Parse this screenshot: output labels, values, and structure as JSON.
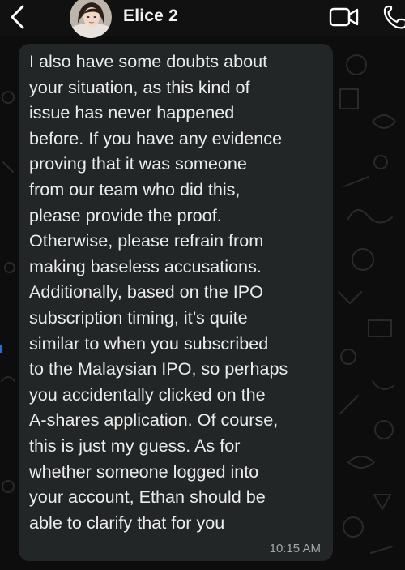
{
  "header": {
    "contact_name": "Elice 2",
    "back_icon": "chevron-left-icon",
    "video_icon": "video-camera-icon",
    "call_icon": "phone-icon"
  },
  "message": {
    "text": "I also have some doubts about\nyour situation, as this kind of\nissue has never happened\nbefore. If you have any evidence\nproving that it was someone\nfrom our team who did this,\nplease provide the proof.\nOtherwise, please refrain from\nmaking baseless accusations.\nAdditionally, based on the IPO\nsubscription timing, it’s quite\nsimilar to when you subscribed\nto the Malaysian IPO, so perhaps\nyou accidentally clicked on the\nA-shares application. Of course,\nthis is just my guess. As for\nwhether someone logged into\nyour account, Ethan should be\nable to clarify that for you",
    "time": "10:15 AM"
  },
  "colors": {
    "header_bg": "#111111",
    "chat_bg": "#0d0d0d",
    "bubble_bg": "#232626",
    "text": "#ececec",
    "time": "#a3a6a7"
  }
}
